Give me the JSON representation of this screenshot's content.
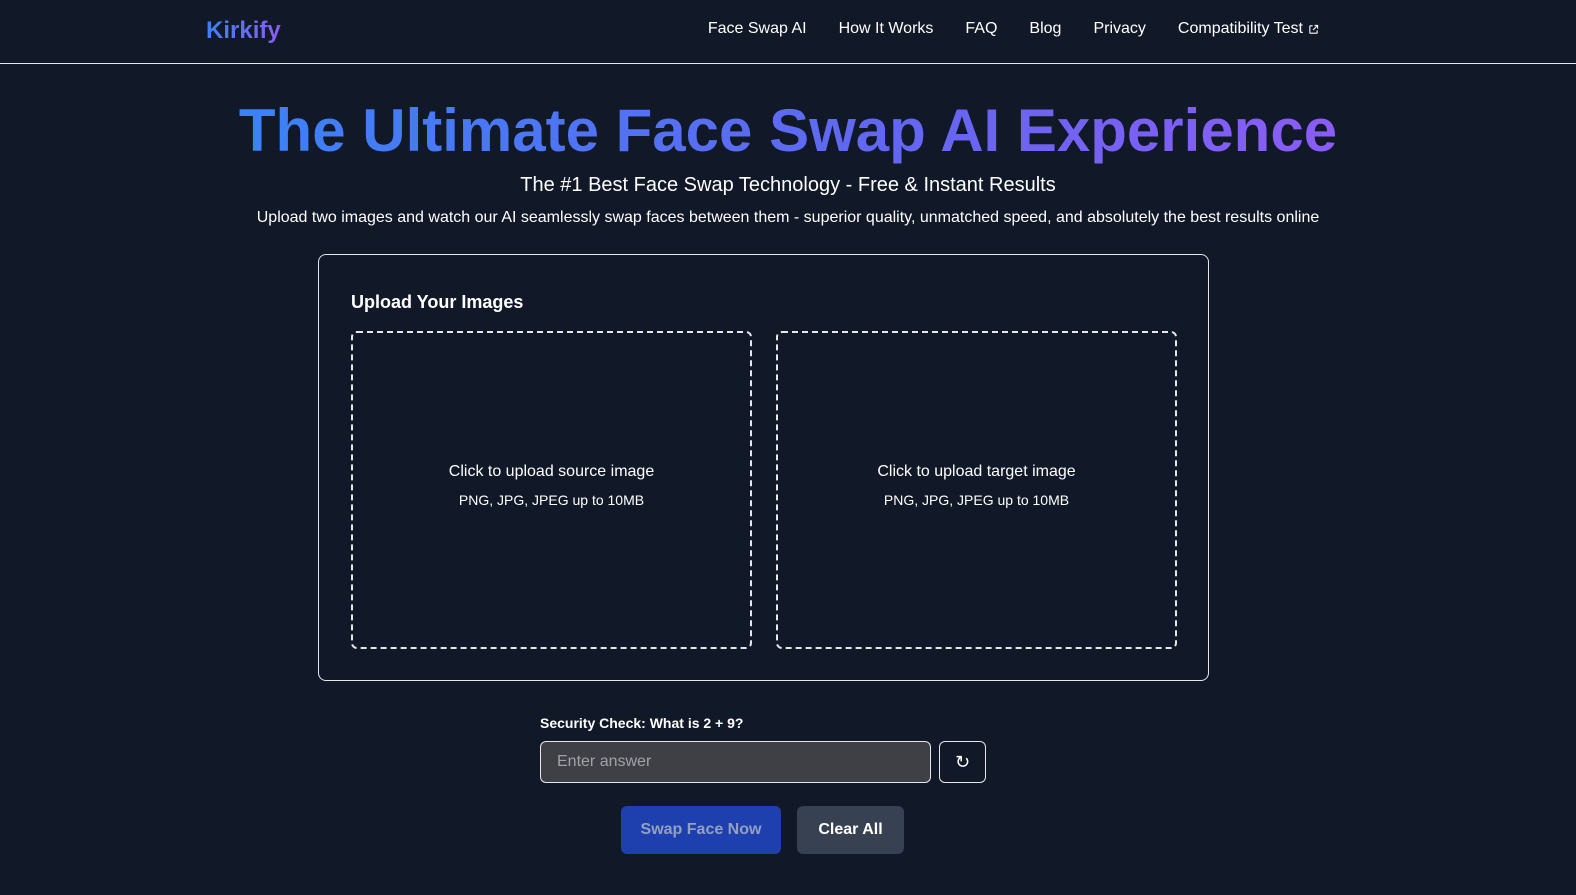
{
  "nav": {
    "brand": "Kirkify",
    "links": [
      "Face Swap AI",
      "How It Works",
      "FAQ",
      "Blog",
      "Privacy",
      "Compatibility Test"
    ]
  },
  "hero": {
    "title": "The Ultimate Face Swap AI Experience",
    "subtitle": "The #1 Best Face Swap Technology - Free & Instant Results",
    "description": "Upload two images and watch our AI seamlessly swap faces between them - superior quality, unmatched speed, and absolutely the best results online"
  },
  "upload": {
    "title": "Upload Your Images",
    "source_label": "Click to upload source image",
    "target_label": "Click to upload target image",
    "hint": "PNG, JPG, JPEG up to 10MB"
  },
  "security": {
    "label": "Security Check: What is 2 + 9?",
    "placeholder": "Enter answer",
    "refresh_icon": "↻"
  },
  "actions": {
    "swap_label": "Swap Face Now",
    "clear_label": "Clear All"
  },
  "colors": {
    "background": "#111827",
    "accent_start": "#3b82f6",
    "accent_end": "#8b5cf6",
    "swap_button": "#1e40af",
    "clear_button": "#374151"
  }
}
